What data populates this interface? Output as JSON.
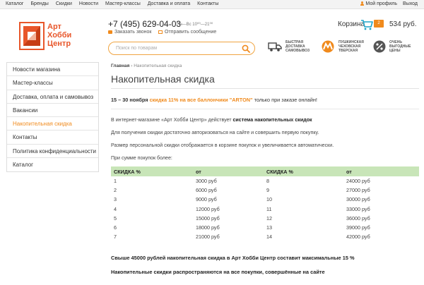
{
  "topbar": {
    "nav": [
      "Каталог",
      "Бренды",
      "Скидки",
      "Новости",
      "Мастер-классы",
      "Доставка и оплата",
      "Контакты"
    ],
    "profile": "Мой профиль",
    "logout": "Выход"
  },
  "logo": {
    "line1": "Арт",
    "line2": "Хобби",
    "line3": "Центр"
  },
  "header": {
    "phone": "+7 (495) 629-04-03",
    "hours": "Пн—Вс 10⁰⁰—21⁰⁰",
    "call_link": "Заказать звонок",
    "msg_link": "Отправить сообщение",
    "search_placeholder": "Поиск по товарам"
  },
  "cart": {
    "label": "Корзина",
    "count": "2",
    "sum": "534 руб."
  },
  "features": [
    {
      "icon": "truck-icon",
      "text": "БЫСТРАЯ ДОСТАВКА САМОВЫВОЗ"
    },
    {
      "icon": "metro-icon",
      "text": "ПУШКИНСКАЯ ЧЕХОВСКАЯ ТВЕРСКАЯ"
    },
    {
      "icon": "percent-icon",
      "text": "ОЧЕНЬ ВЫГОДНЫЕ ЦЕНЫ"
    }
  ],
  "sidebar": {
    "items": [
      {
        "label": "Новости магазина"
      },
      {
        "label": "Мастер-классы"
      },
      {
        "label": "Доставка, оплата и самовывоз"
      },
      {
        "label": "Вакансии"
      },
      {
        "label": "Накопительная скидка",
        "active": true
      },
      {
        "label": "Контакты"
      },
      {
        "label": "Политика конфиденциальности"
      },
      {
        "label": "Каталог"
      }
    ]
  },
  "main": {
    "crumb_home": "Главная",
    "crumb_sep": "›",
    "crumb_current": "Накопительная скидка",
    "title": "Накопительная скидка",
    "promo": {
      "dates": "15 – 30 ноября",
      "offer": "скидка 11%  на все баллончики \"ARTON\"",
      "tail": "только при заказе онлайн!"
    },
    "p1_start": "В интернет-магазине «Арт Хобби Центр» действует",
    "p1_bold": "система накопительных скидок",
    "p2": "Для получения скидки достаточно авторизоваться на сайте и совершить первую покупку.",
    "p3": "Размер персональной скидки отображается в корзине покупок и увеличивается автоматически.",
    "p4": "При сумме покупок более:",
    "table": {
      "headers": [
        "СКИДКА %",
        "от",
        "СКИДКА %",
        "от"
      ],
      "rows": [
        [
          "1",
          "3000 руб",
          "8",
          "24000 руб"
        ],
        [
          "2",
          "6000 руб",
          "9",
          "27000 руб"
        ],
        [
          "3",
          "9000 руб",
          "10",
          "30000 руб"
        ],
        [
          "4",
          "12000 руб",
          "11",
          "33000 руб"
        ],
        [
          "5",
          "15000 руб",
          "12",
          "36000 руб"
        ],
        [
          "6",
          "18000 руб",
          "13",
          "39000 руб"
        ],
        [
          "7",
          "21000 руб",
          "14",
          "42000 руб"
        ]
      ]
    },
    "note1": "Свыше 45000 рублей накопительная скидка в Арт Хобби Центр составит максимальные 15 %",
    "note2": "Накопительные скидки распространяются на все покупки, совершённые на сайте"
  },
  "colors": {
    "accent": "#f08a1c",
    "logo": "#e8562a",
    "table_header": "#c8e5b8"
  }
}
